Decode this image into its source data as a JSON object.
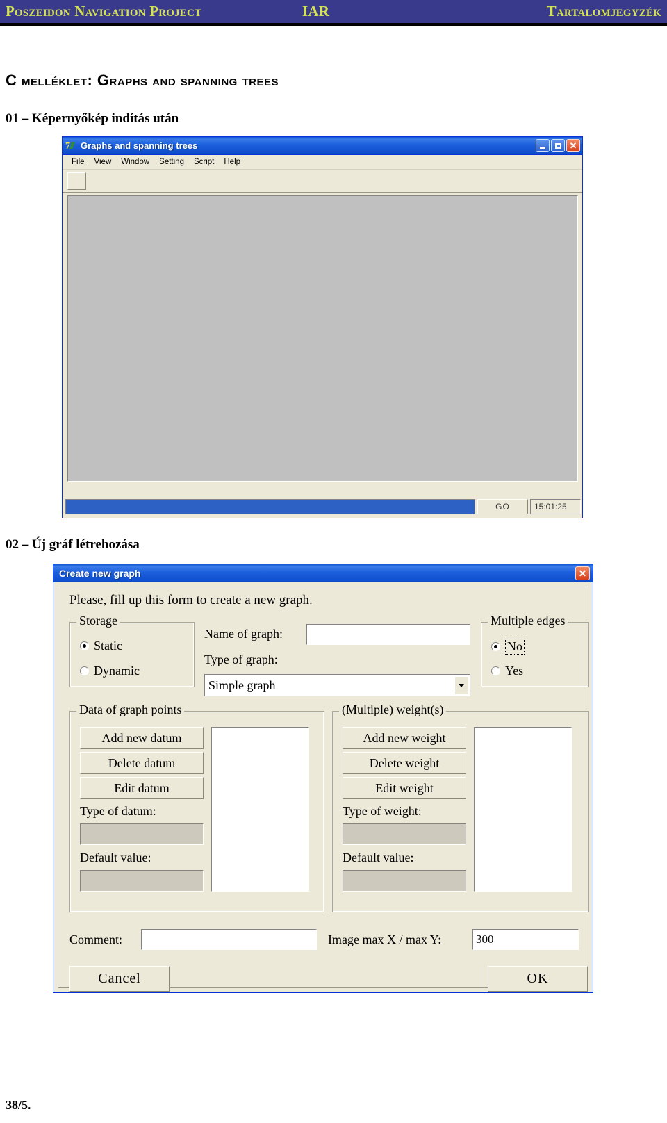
{
  "page": {
    "header": {
      "left": "Poszeidon Navigation Project",
      "middle": "IAR",
      "right": "Tartalomjegyzék",
      "bg_color": "#3a3a8c",
      "text_color": "#d4e157"
    },
    "doc_title": "C melléklet: Graphs and spanning trees",
    "section_01": "01 – Képernyőkép indítás után",
    "section_02": "02 – Új gráf létrehozása",
    "footer": "38/5."
  },
  "window_main": {
    "title": "Graphs and spanning trees",
    "icon": "app-icon",
    "menu": [
      {
        "label": "File"
      },
      {
        "label": "View"
      },
      {
        "label": "Window"
      },
      {
        "label": "Setting"
      },
      {
        "label": "Script"
      },
      {
        "label": "Help"
      }
    ],
    "caption_buttons": {
      "minimize": "minimize-icon",
      "maximize": "maximize-icon",
      "close": "✕"
    },
    "toolbar": {
      "button1": ""
    },
    "status": {
      "progress_value": "",
      "go_label": "GO",
      "time": "15:01:25",
      "progress_color": "#2d62c4"
    }
  },
  "dialog_create_graph": {
    "title": "Create new graph",
    "close_label": "✕",
    "instruction": "Please, fill up this form to create a new graph.",
    "storage": {
      "legend": "Storage",
      "options": [
        {
          "label": "Static",
          "selected": true
        },
        {
          "label": "Dynamic",
          "selected": false
        }
      ]
    },
    "name_of_graph": {
      "label": "Name of graph:",
      "value": ""
    },
    "type_of_graph": {
      "label": "Type of graph:",
      "value": "Simple graph"
    },
    "multiple_edges": {
      "legend": "Multiple edges",
      "options": [
        {
          "label": "No",
          "selected": true,
          "focused": true
        },
        {
          "label": "Yes",
          "selected": false,
          "focused": false
        }
      ]
    },
    "data_points": {
      "legend": "Data of graph points",
      "buttons": [
        "Add new datum",
        "Delete datum",
        "Edit datum"
      ],
      "type_label": "Type of datum:",
      "type_value": "",
      "default_label": "Default value:",
      "default_value": "",
      "list_items": []
    },
    "weights": {
      "legend": "(Multiple) weight(s)",
      "buttons": [
        "Add new weight",
        "Delete weight",
        "Edit weight"
      ],
      "type_label": "Type of weight:",
      "type_value": "",
      "default_label": "Default value:",
      "default_value": "",
      "list_items": []
    },
    "comment": {
      "label": "Comment:",
      "value": ""
    },
    "image_max": {
      "label": "Image max X / max Y:",
      "value": "300"
    },
    "cancel_label": "Cancel",
    "ok_label": "OK"
  }
}
